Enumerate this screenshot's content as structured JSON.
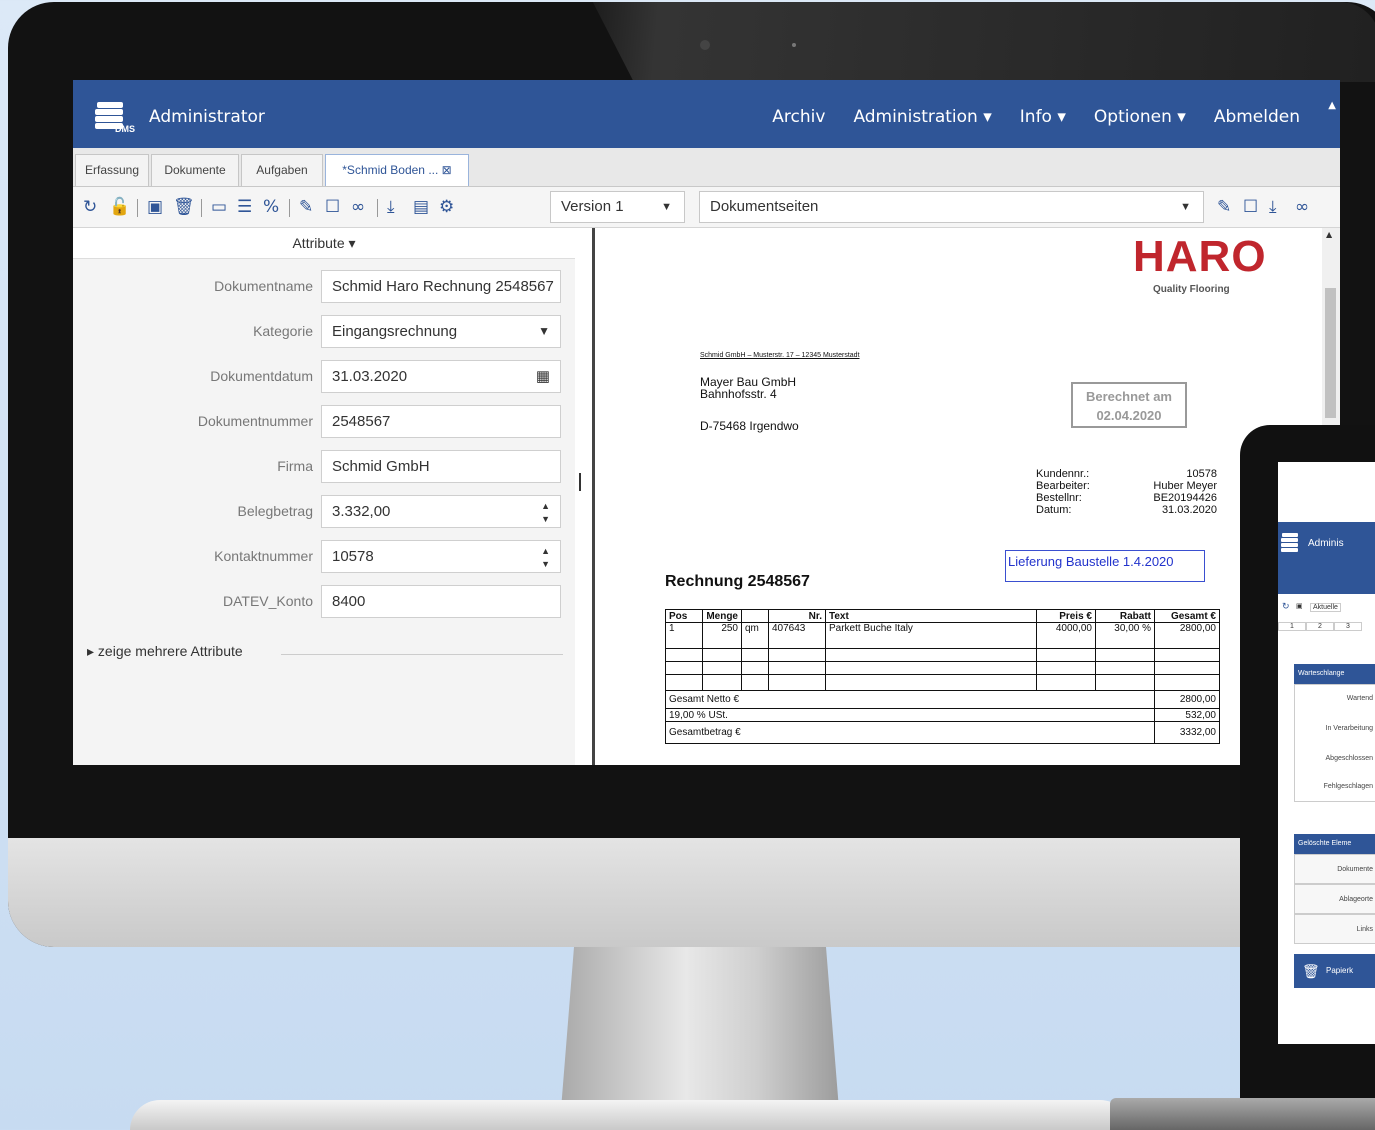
{
  "app": {
    "user_title": "Administrator",
    "nav": [
      "Archiv",
      "Administration ▾",
      "Info ▾",
      "Optionen ▾",
      "Abmelden"
    ]
  },
  "tabs": [
    "Erfassung",
    "Dokumente",
    "Aufgaben",
    "*Schmid Boden ... ⊠"
  ],
  "toolbar": {
    "version_select": "Version 1",
    "pages_select": "Dokumentseiten"
  },
  "attributes": {
    "header": "Attribute ▾",
    "fields": [
      {
        "label": "Dokumentname",
        "value": "Schmid Haro Rechnung 2548567"
      },
      {
        "label": "Kategorie",
        "value": "Eingangsrechnung"
      },
      {
        "label": "Dokumentdatum",
        "value": "31.03.2020"
      },
      {
        "label": "Dokumentnummer",
        "value": "2548567"
      },
      {
        "label": "Firma",
        "value": "Schmid GmbH"
      },
      {
        "label": "Belegbetrag",
        "value": "3.332,00"
      },
      {
        "label": "Kontaktnummer",
        "value": "10578"
      },
      {
        "label": "DATEV_Konto",
        "value": "8400"
      }
    ],
    "more_link": "▸ zeige mehrere Attribute"
  },
  "invoice": {
    "logo": "HARO",
    "logo_sub": "Quality Flooring",
    "sender_line": "Schmid GmbH – Musterstr. 17 – 12345 Musterstadt",
    "recipient": [
      "Mayer Bau GmbH",
      "Bahnhofsstr. 4",
      "D-75468 Irgendwo"
    ],
    "stamp_line1": "Berechnet am",
    "stamp_line2": "02.04.2020",
    "meta_labels": [
      "Kundennr.:",
      "Bearbeiter:",
      "Bestellnr:",
      "Datum:"
    ],
    "meta_values": [
      "10578",
      "Huber Meyer",
      "BE20194426",
      "31.03.2020"
    ],
    "note": "Lieferung Baustelle 1.4.2020",
    "title": "Rechnung 2548567",
    "table_headers": [
      "Pos",
      "Menge",
      "",
      "Nr.",
      "Text",
      "Preis €",
      "Rabatt",
      "Gesamt €"
    ],
    "row": [
      "1",
      "250",
      "qm",
      "407643",
      "Parkett Buche Italy",
      "4000,00",
      "30,00 %",
      "2800,00"
    ],
    "totals": [
      {
        "label": "Gesamt Netto €",
        "value": "2800,00"
      },
      {
        "label": "19,00 % USt.",
        "value": "532,00"
      },
      {
        "label": "Gesamtbetrag €",
        "value": "3332,00"
      }
    ]
  },
  "laptop": {
    "title": "Adminis",
    "toolbar_text": "Aktuelle",
    "pages": [
      "1",
      "2",
      "3"
    ],
    "group1": "Warteschlange",
    "rows1": [
      "Wartend",
      "In Verarbeitung",
      "Abgeschlossen",
      "Fehlgeschlagen"
    ],
    "group2": "Gelöschte Eleme",
    "rows2": [
      "Dokumente",
      "Ablageorte",
      "Links"
    ],
    "trash_button": "Papierk"
  },
  "colors": {
    "brand": "#2f5597",
    "haro_red": "#c0262d"
  }
}
